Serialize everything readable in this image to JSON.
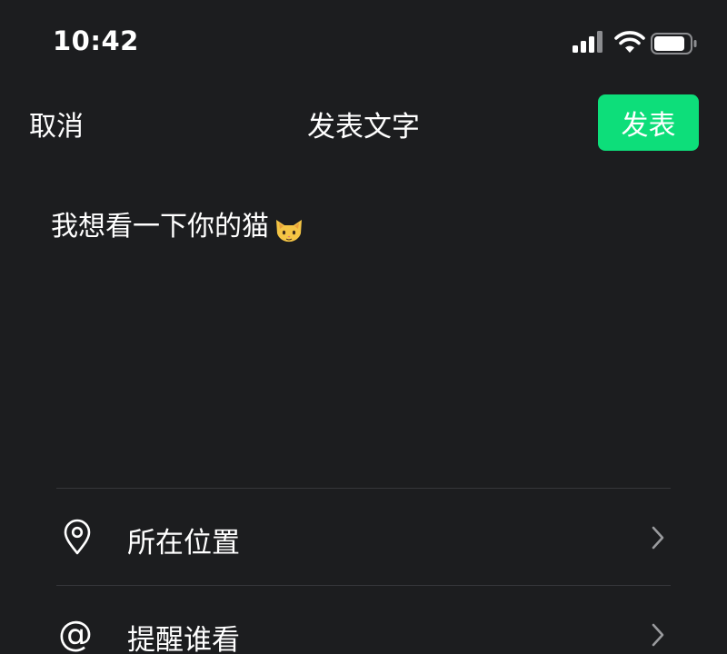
{
  "status_bar": {
    "time": "10:42",
    "icons": [
      "signal-icon",
      "wifi-icon",
      "battery-icon"
    ]
  },
  "nav": {
    "cancel_label": "取消",
    "title": "发表文字",
    "publish_label": "发表",
    "publish_color": "#0dde7a"
  },
  "composer": {
    "text": "我想看一下你的猫",
    "emoji": "cat-face-icon"
  },
  "options": [
    {
      "label": "所在位置",
      "icon": "location-pin-icon"
    },
    {
      "label": "提醒谁看",
      "icon": "at-sign-icon"
    }
  ],
  "theme": {
    "background": "#1c1d1f",
    "divider": "#35363a",
    "accent": "#0dde7a"
  }
}
